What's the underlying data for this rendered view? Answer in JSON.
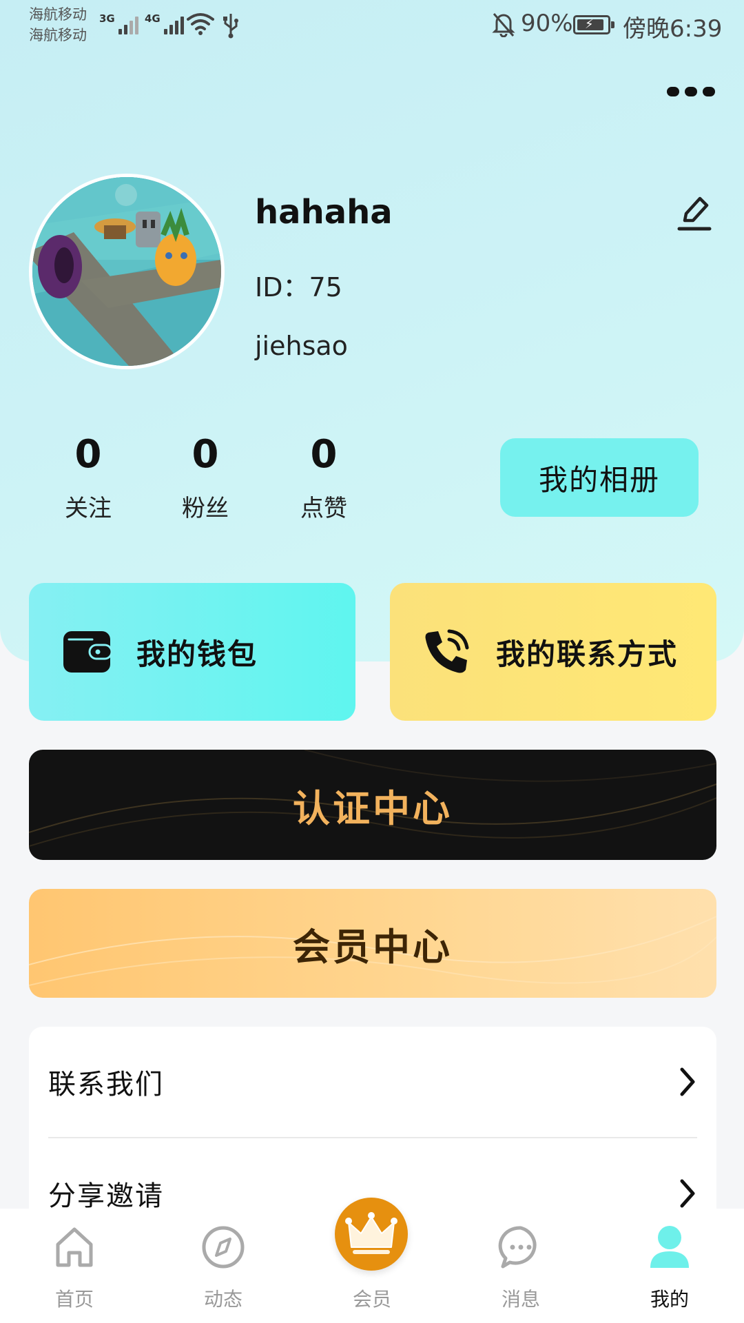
{
  "status_bar": {
    "carrier_1": "海航移动",
    "carrier_2": "海航移动",
    "sim1_network": "3G",
    "sim2_network": "4G",
    "battery_percent": "90%",
    "battery_level": 0.9,
    "time": "傍晚6:39"
  },
  "profile": {
    "username": "hahaha",
    "id_text": "ID：75",
    "signature": "jiehsao"
  },
  "stats": [
    {
      "value": "0",
      "label": "关注"
    },
    {
      "value": "0",
      "label": "粉丝"
    },
    {
      "value": "0",
      "label": "点赞"
    }
  ],
  "album_button": "我的相册",
  "cards": {
    "wallet": "我的钱包",
    "contact": "我的联系方式"
  },
  "banners": {
    "certification": "认证中心",
    "vip": "会员中心"
  },
  "menu": [
    {
      "label": "联系我们"
    },
    {
      "label": "分享邀请"
    }
  ],
  "tabbar": [
    {
      "label": "首页",
      "icon": "home-icon"
    },
    {
      "label": "动态",
      "icon": "compass-icon"
    },
    {
      "label": "会员",
      "icon": "crown-icon"
    },
    {
      "label": "消息",
      "icon": "chat-icon"
    },
    {
      "label": "我的",
      "icon": "user-icon",
      "active": true
    }
  ],
  "colors": {
    "accent_cyan": "#76f1ee",
    "accent_yellow": "#ffe875",
    "cert_gold": "#f2b25d",
    "vip_orange": "#e6900f"
  }
}
